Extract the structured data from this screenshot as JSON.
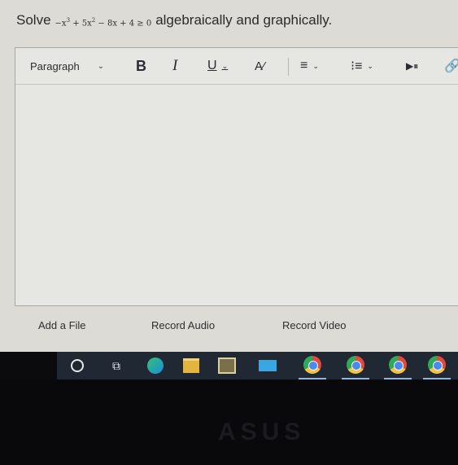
{
  "question": {
    "lead": "Solve",
    "inequality": {
      "p1": "−x",
      "p1_exp": "3",
      "p2": " + 5x",
      "p2_exp": "2",
      "p3": " − 8x + 4 ≥ 0"
    },
    "trail": "algebraically and graphically."
  },
  "toolbar": {
    "paragraph_label": "Paragraph",
    "chevron": "⌄",
    "bold": "B",
    "italic": "I",
    "underline": "U",
    "text_color": "A⁄",
    "align": "≡",
    "list": "⁝≡",
    "media": "▶⏸",
    "link": "🔗"
  },
  "attachments": {
    "add_file": "Add a File",
    "record_audio": "Record Audio",
    "record_video": "Record Video"
  },
  "taskbar": {
    "taskview_icon": "⧉"
  },
  "bezel": {
    "brand": "ASUS"
  },
  "colors": {
    "screen_bg": "#dcdbd6",
    "taskbar_bg": "#1f2833"
  }
}
